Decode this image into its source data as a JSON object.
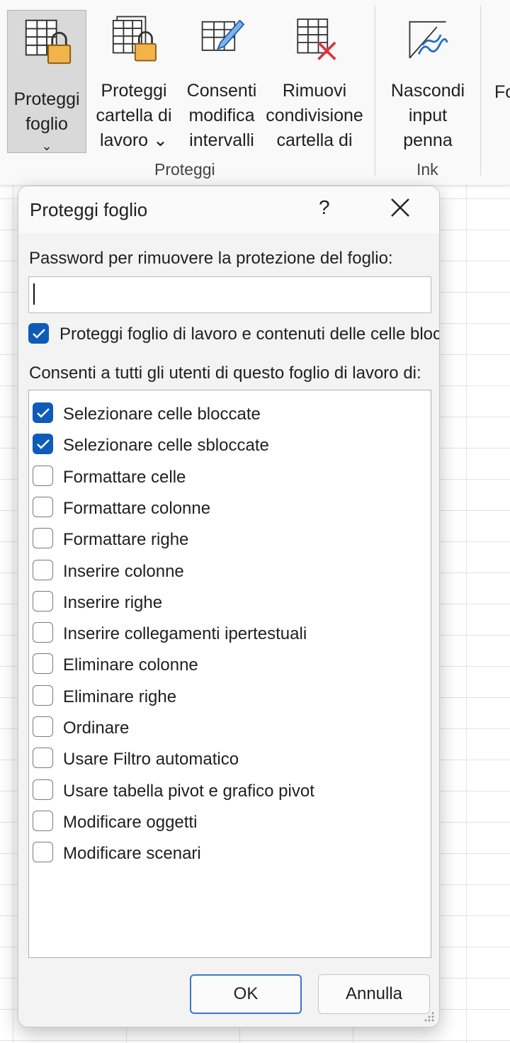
{
  "ribbon": {
    "buttons": [
      {
        "label": "Proteggi\nfoglio",
        "icon": "protect-sheet-icon",
        "active": true,
        "caret": "⌄"
      },
      {
        "label": "Proteggi\ncartella di\nlavoro ⌄",
        "icon": "protect-workbook-icon"
      },
      {
        "label": "Consenti\nmodifica\nintervalli",
        "icon": "allow-edit-ranges-icon"
      },
      {
        "label": "Rimuovi\ncondivisione\ncartella di",
        "icon": "unshare-workbook-icon"
      },
      {
        "label": "Nascondi\ninput\npenna",
        "icon": "hide-ink-icon"
      }
    ],
    "group_proteggi": "Proteggi",
    "group_ink": "Ink",
    "cut_off_label": "Fo"
  },
  "dialog": {
    "title": "Proteggi foglio",
    "help": "?",
    "password_label": "Password per rimuovere la protezione del foglio:",
    "password_value": "",
    "protect_checkbox_label": "Proteggi foglio di lavoro e contenuti delle celle bloccate",
    "protect_checked": true,
    "allow_label": "Consenti a tutti gli utenti di questo foglio di lavoro di:",
    "permissions": [
      {
        "label": "Selezionare celle bloccate",
        "checked": true
      },
      {
        "label": "Selezionare celle sbloccate",
        "checked": true
      },
      {
        "label": "Formattare celle",
        "checked": false
      },
      {
        "label": "Formattare colonne",
        "checked": false
      },
      {
        "label": "Formattare righe",
        "checked": false
      },
      {
        "label": "Inserire colonne",
        "checked": false
      },
      {
        "label": "Inserire righe",
        "checked": false
      },
      {
        "label": "Inserire collegamenti ipertestuali",
        "checked": false
      },
      {
        "label": "Eliminare colonne",
        "checked": false
      },
      {
        "label": "Eliminare righe",
        "checked": false
      },
      {
        "label": "Ordinare",
        "checked": false
      },
      {
        "label": "Usare Filtro automatico",
        "checked": false
      },
      {
        "label": "Usare tabella pivot e grafico pivot",
        "checked": false
      },
      {
        "label": "Modificare oggetti",
        "checked": false
      },
      {
        "label": "Modificare scenari",
        "checked": false
      }
    ],
    "ok_label": "OK",
    "cancel_label": "Annulla"
  },
  "colors": {
    "accent": "#0f5bb8",
    "ok_border": "#3b77c4",
    "lock": "#f2b34a",
    "remove_x": "#d9363e"
  }
}
